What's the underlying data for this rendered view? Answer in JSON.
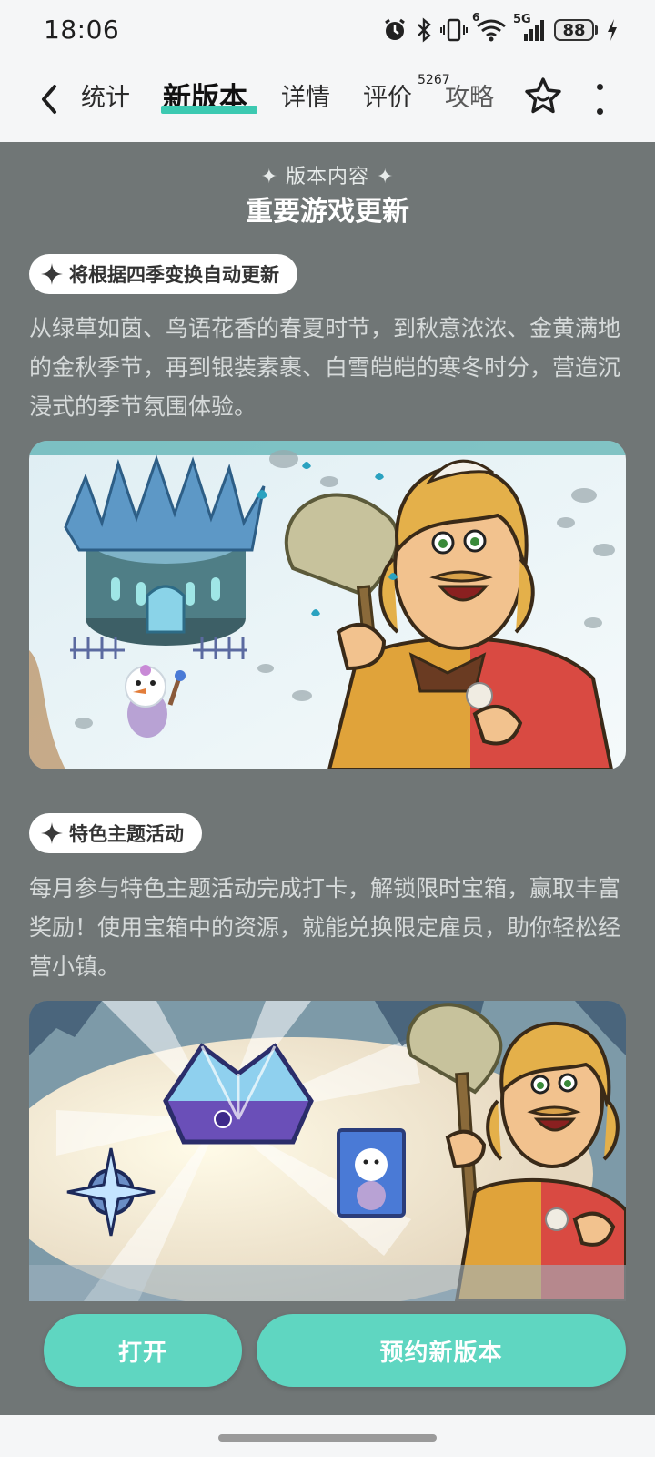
{
  "status_bar": {
    "time": "18:06",
    "battery_level": "88",
    "network_label": "5G",
    "wifi_label": "6"
  },
  "nav": {
    "tabs": [
      {
        "label": "统计",
        "active": false
      },
      {
        "label": "新版本",
        "active": true
      },
      {
        "label": "详情",
        "active": false
      },
      {
        "label": "评价",
        "active": false
      },
      {
        "label": "攻略",
        "active": false
      }
    ],
    "review_count": "5267"
  },
  "section": {
    "kicker": "✦ 版本内容 ✦",
    "title": "重要游戏更新"
  },
  "features": [
    {
      "tag": "将根据四季变换自动更新",
      "description": "从绿草如茵、鸟语花香的春夏时节，到秋意浓浓、金黄满地的金秋季节，再到银装素裹、白雪皑皑的寒冬时分，营造沉浸式的季节氛围体验。"
    },
    {
      "tag": "特色主题活动",
      "description": "每月参与特色主题活动完成打卡，解锁限时宝箱，赢取丰富奖励！使用宝箱中的资源，就能兑换限定雇员，助你轻松经营小镇。"
    }
  ],
  "actions": {
    "open_label": "打开",
    "reserve_label": "预约新版本"
  },
  "colors": {
    "accent": "#3cc9b1",
    "button": "#5fd6c1",
    "content_bg": "#707676"
  }
}
